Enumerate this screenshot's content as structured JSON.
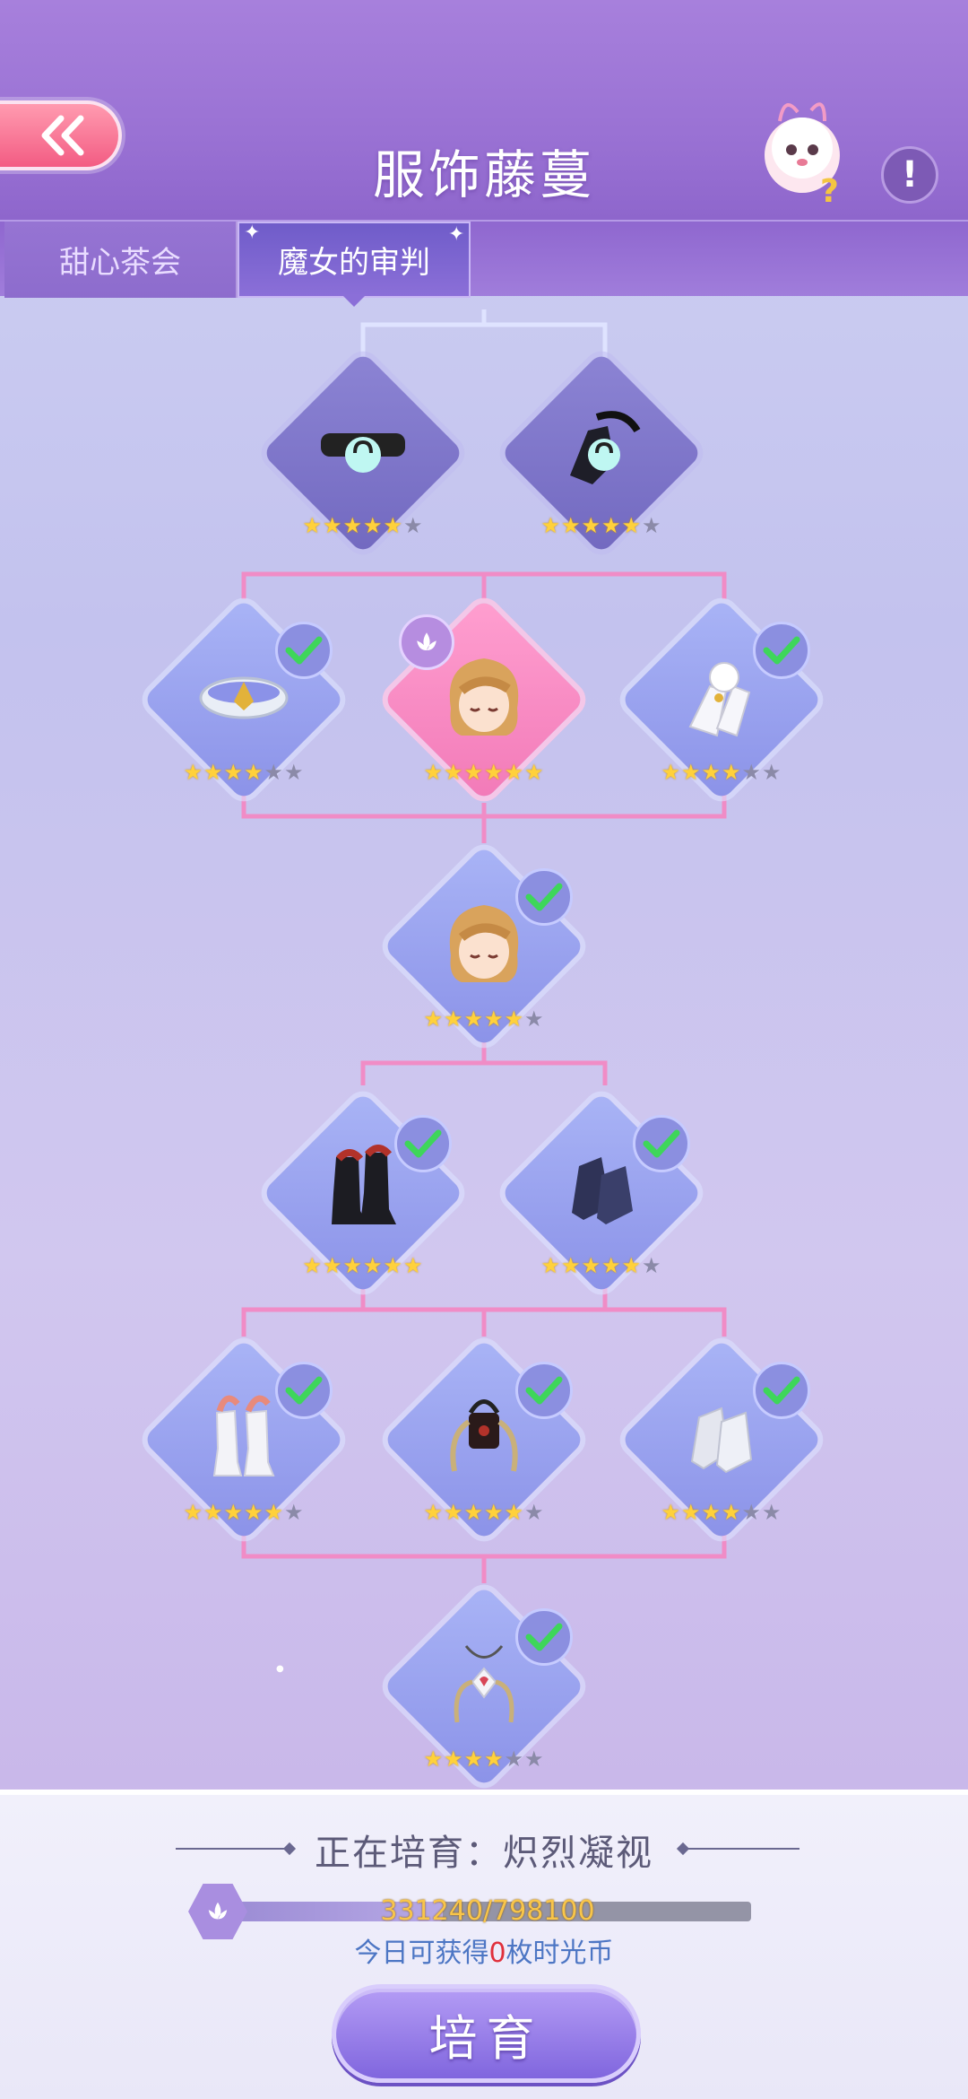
{
  "header": {
    "title": "服饰藤蔓",
    "help_label": "!"
  },
  "tabs": [
    {
      "label": "甜心茶会",
      "active": false
    },
    {
      "label": "魔女的审判",
      "active": true
    }
  ],
  "tree": {
    "nodes": [
      {
        "id": "choker",
        "stars": 5,
        "max": 6,
        "state": "locked"
      },
      {
        "id": "black-gloves",
        "stars": 5,
        "max": 6,
        "state": "locked"
      },
      {
        "id": "gold-bracelet",
        "stars": 4,
        "max": 6,
        "state": "done"
      },
      {
        "id": "hair-current",
        "stars": 6,
        "max": 6,
        "state": "current"
      },
      {
        "id": "lace-gloves",
        "stars": 4,
        "max": 6,
        "state": "done"
      },
      {
        "id": "hair-blonde",
        "stars": 5,
        "max": 6,
        "state": "done"
      },
      {
        "id": "red-black-boots",
        "stars": 6,
        "max": 6,
        "state": "done"
      },
      {
        "id": "navy-socks",
        "stars": 5,
        "max": 6,
        "state": "done"
      },
      {
        "id": "white-heels",
        "stars": 5,
        "max": 6,
        "state": "done"
      },
      {
        "id": "winged-bag",
        "stars": 5,
        "max": 6,
        "state": "done"
      },
      {
        "id": "white-socks",
        "stars": 4,
        "max": 6,
        "state": "done"
      },
      {
        "id": "heart-necklace",
        "stars": 4,
        "max": 6,
        "state": "done"
      }
    ]
  },
  "footer": {
    "cultivating_label": "正在培育：炽烈凝视",
    "progress_text": "331240/798100",
    "progress_fraction": 0.415,
    "today_prefix": "今日可获得",
    "today_count": "0",
    "today_suffix": "枚时光币",
    "cultivate_button": "培育"
  },
  "colors": {
    "header": "#9a72d4",
    "accent_pink": "#f35c83",
    "star": "#ffd13b",
    "tree_line": "#f08cc6"
  }
}
